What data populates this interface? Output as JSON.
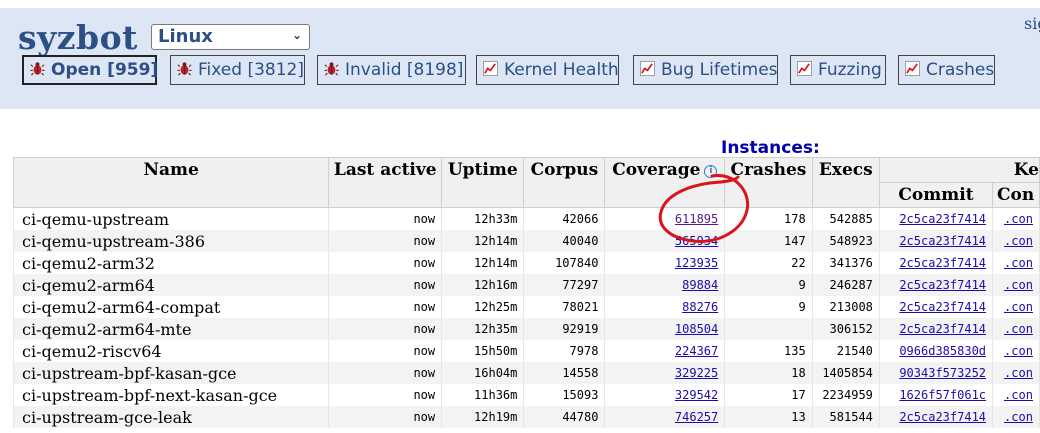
{
  "header": {
    "logo": "syzbot",
    "namespace_selected": "Linux",
    "signin_text": "sig"
  },
  "tabs": [
    {
      "label": "Open [959]",
      "icon": "bug-icon",
      "active": true
    },
    {
      "label": "Fixed [3812]",
      "icon": "bug-icon",
      "active": false
    },
    {
      "label": "Invalid [8198]",
      "icon": "bug-icon",
      "active": false
    },
    {
      "label": "Kernel Health",
      "icon": "chart-icon",
      "active": false
    },
    {
      "label": "Bug Lifetimes",
      "icon": "chart-icon",
      "active": false
    },
    {
      "label": "Fuzzing",
      "icon": "chart-icon",
      "active": false
    },
    {
      "label": "Crashes",
      "icon": "chart-icon",
      "active": false
    }
  ],
  "instances": {
    "title": "Instances:",
    "columns": {
      "name": "Name",
      "last_active": "Last active",
      "uptime": "Uptime",
      "corpus": "Corpus",
      "coverage": "Coverage",
      "crashes": "Crashes",
      "execs": "Execs",
      "kernel": "Ke",
      "commit": "Commit",
      "config": "Con"
    },
    "rows": [
      {
        "name": "ci-qemu-upstream",
        "last_active": "now",
        "uptime": "12h33m",
        "corpus": "42066",
        "coverage": "611895",
        "crashes": "178",
        "execs": "542885",
        "commit": "2c5ca23f7414",
        "config": ".con"
      },
      {
        "name": "ci-qemu-upstream-386",
        "last_active": "now",
        "uptime": "12h14m",
        "corpus": "40040",
        "coverage": "565934",
        "crashes": "147",
        "execs": "548923",
        "commit": "2c5ca23f7414",
        "config": ".con"
      },
      {
        "name": "ci-qemu2-arm32",
        "last_active": "now",
        "uptime": "12h14m",
        "corpus": "107840",
        "coverage": "123935",
        "crashes": "22",
        "execs": "341376",
        "commit": "2c5ca23f7414",
        "config": ".con"
      },
      {
        "name": "ci-qemu2-arm64",
        "last_active": "now",
        "uptime": "12h16m",
        "corpus": "77297",
        "coverage": "89884",
        "crashes": "9",
        "execs": "246287",
        "commit": "2c5ca23f7414",
        "config": ".con"
      },
      {
        "name": "ci-qemu2-arm64-compat",
        "last_active": "now",
        "uptime": "12h25m",
        "corpus": "78021",
        "coverage": "88276",
        "crashes": "9",
        "execs": "213008",
        "commit": "2c5ca23f7414",
        "config": ".con"
      },
      {
        "name": "ci-qemu2-arm64-mte",
        "last_active": "now",
        "uptime": "12h35m",
        "corpus": "92919",
        "coverage": "108504",
        "crashes": "",
        "execs": "306152",
        "commit": "2c5ca23f7414",
        "config": ".con"
      },
      {
        "name": "ci-qemu2-riscv64",
        "last_active": "now",
        "uptime": "15h50m",
        "corpus": "7978",
        "coverage": "224367",
        "crashes": "135",
        "execs": "21540",
        "commit": "0966d385830d",
        "config": ".con"
      },
      {
        "name": "ci-upstream-bpf-kasan-gce",
        "last_active": "now",
        "uptime": "16h04m",
        "corpus": "14558",
        "coverage": "329225",
        "crashes": "18",
        "execs": "1405854",
        "commit": "90343f573252",
        "config": ".con"
      },
      {
        "name": "ci-upstream-bpf-next-kasan-gce",
        "last_active": "now",
        "uptime": "11h36m",
        "corpus": "15093",
        "coverage": "329542",
        "crashes": "17",
        "execs": "2234959",
        "commit": "1626f57f061c",
        "config": ".con"
      },
      {
        "name": "ci-upstream-gce-leak",
        "last_active": "now",
        "uptime": "12h19m",
        "corpus": "44780",
        "coverage": "746257",
        "crashes": "13",
        "execs": "581544",
        "commit": "2c5ca23f7414",
        "config": ".con"
      }
    ]
  },
  "colors": {
    "header_bg": "#dde6f4",
    "brand": "#2c4f86",
    "annotation_circle": "#d9141c"
  }
}
